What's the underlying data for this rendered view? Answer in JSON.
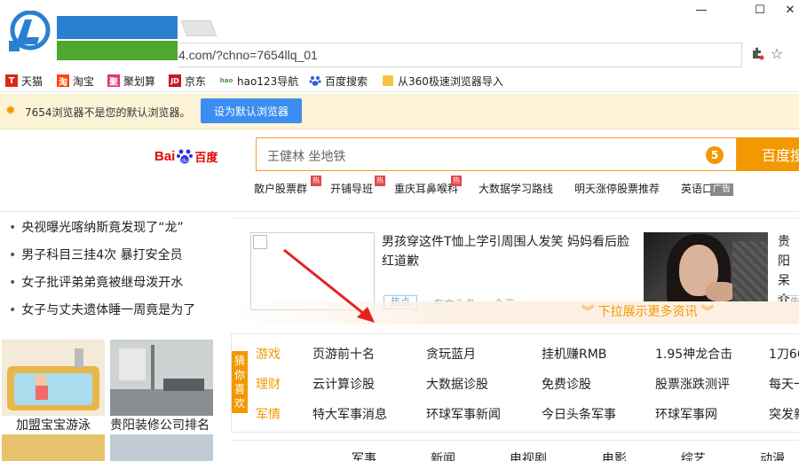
{
  "window": {
    "minimize_label": "—",
    "maximize_label": "☐",
    "close_label": "✕"
  },
  "address_bar": {
    "url": "4.com/?chno=7654llq_01",
    "extension_icon": "puzzle-icon",
    "bookmark_icon": "star-icon"
  },
  "bookmarks": [
    {
      "label": "天猫",
      "icon": "T"
    },
    {
      "label": "淘宝",
      "icon": "淘"
    },
    {
      "label": "聚划算",
      "icon": "聚"
    },
    {
      "label": "京东",
      "icon": "JD"
    },
    {
      "label": "hao123导航",
      "icon": "hao"
    },
    {
      "label": "百度搜索",
      "icon": "paw"
    },
    {
      "label": "从360极速浏览器导入",
      "icon": "folder"
    }
  ],
  "notice": {
    "text": "7654浏览器不是您的默认浏览器。",
    "button": "设为默认浏览器"
  },
  "baidu": {
    "logo_bai": "Bai",
    "logo_du": "百度",
    "search_value": "王健林 坐地铁",
    "search_count": "5",
    "search_button": "百度搜",
    "hot_links": [
      "散户股票群",
      "开铺导班",
      "重庆耳鼻喉科",
      "大数据学习路线",
      "明天涨停股票推荐",
      "英语口"
    ],
    "hot_badge": "热",
    "ad_label": "广告"
  },
  "left_news": [
    "央视曝光喀纳斯竟发现了“龙”",
    "男子科目三挂4次 暴打安全员",
    "女子批评弟弟竟被继母泼开水",
    "女子与丈夫遗体睡一周竟是为了"
  ],
  "news_card": {
    "title": "男孩穿这件T恤上学引周围人发笑 妈妈看后脸红道歉",
    "tag": "热点",
    "source": "东方头条",
    "time": "今天",
    "right_title": "贵阳 呆众",
    "right_tag": "广告"
  },
  "pulldown": {
    "text": "︾ 下拉展示更多资讯 ︾"
  },
  "thumbs": [
    {
      "caption": "加盟宝宝游泳"
    },
    {
      "caption": "贵阳装修公司排名"
    }
  ],
  "guess": {
    "label": "猜你喜欢",
    "rows": [
      {
        "category": "游戏",
        "items": [
          "页游前十名",
          "贪玩蓝月",
          "挂机赚RMB",
          "1.95神龙合击",
          "1刀66"
        ]
      },
      {
        "category": "理财",
        "items": [
          "云计算诊股",
          "大数据诊股",
          "免费诊股",
          "股票涨跌测评",
          "每天一"
        ]
      },
      {
        "category": "军情",
        "items": [
          "特大军事消息",
          "环球军事新闻",
          "今日头条军事",
          "环球军事网",
          "突发新"
        ]
      }
    ]
  },
  "bottom_tabs": [
    "军事",
    "新闻",
    "电视剧",
    "电影",
    "综艺",
    "动漫"
  ],
  "colors": {
    "accent_orange": "#f39800",
    "button_blue": "#3b8ef0",
    "baidu_red": "#e10601",
    "notice_bg": "#fdf3d6"
  }
}
